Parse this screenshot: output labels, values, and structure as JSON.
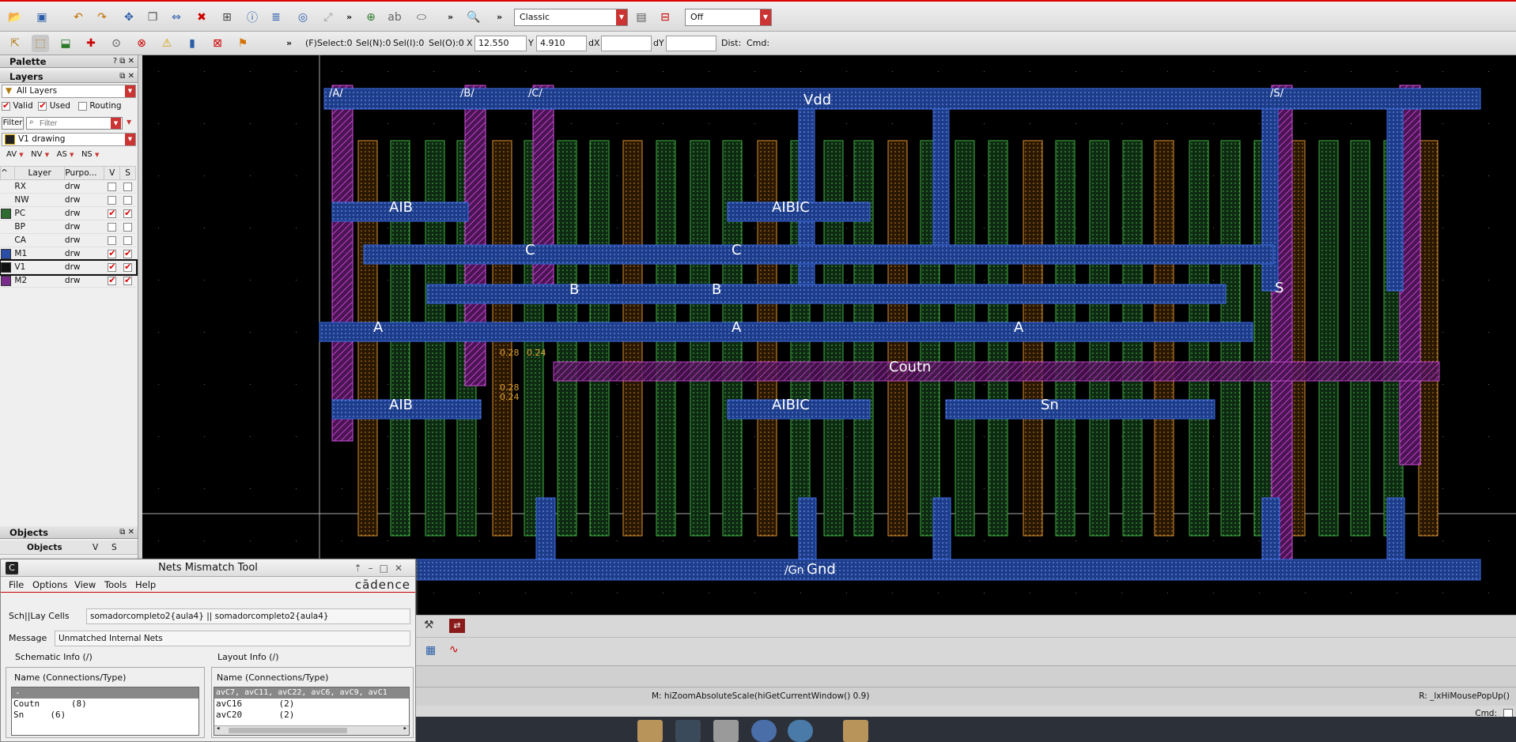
{
  "toolbar": {
    "display_style": "Classic",
    "snap_mode": "Off",
    "overflow_glyph": "»"
  },
  "coordbar": {
    "fselect": "(F)Select:0",
    "seln": "Sel(N):0",
    "seli": "Sel(I):0",
    "selo": "Sel(O):0",
    "x_label": "X",
    "x_value": "12.550",
    "y_label": "Y",
    "y_value": "4.910",
    "dx_label": "dX",
    "dx_value": "",
    "dy_label": "dY",
    "dy_value": "",
    "dist_label": "Dist:",
    "cmd_label": "Cmd:"
  },
  "palette": {
    "title": "Palette",
    "layers_title": "Layers",
    "filter_set": "All Layers",
    "valid_label": "Valid",
    "used_label": "Used",
    "routing_label": "Routing",
    "filter_button": "Filter",
    "filter_placeholder": "Filter",
    "current_layer": "V1 drawing",
    "vis_av": "AV",
    "vis_nv": "NV",
    "vis_as": "AS",
    "vis_ns": "NS",
    "col_layer": "Layer",
    "col_purpose": "Purpo...",
    "col_v": "V",
    "col_s": "S",
    "rows": [
      {
        "layer": "RX",
        "purpose": "drw",
        "v": false,
        "s": false,
        "color": ""
      },
      {
        "layer": "NW",
        "purpose": "drw",
        "v": false,
        "s": false,
        "color": ""
      },
      {
        "layer": "PC",
        "purpose": "drw",
        "v": true,
        "s": true,
        "color": "#2e6b2e"
      },
      {
        "layer": "BP",
        "purpose": "drw",
        "v": false,
        "s": false,
        "color": ""
      },
      {
        "layer": "CA",
        "purpose": "drw",
        "v": false,
        "s": false,
        "color": ""
      },
      {
        "layer": "M1",
        "purpose": "drw",
        "v": true,
        "s": true,
        "color": "#2b4ea8"
      },
      {
        "layer": "V1",
        "purpose": "drw",
        "v": true,
        "s": true,
        "color": "#111111"
      },
      {
        "layer": "M2",
        "purpose": "drw",
        "v": true,
        "s": true,
        "color": "#7a2a8a"
      }
    ],
    "objects_title": "Objects",
    "objects_col": "Objects",
    "objects_v": "V",
    "objects_s": "S"
  },
  "layout": {
    "pins": [
      "/A/",
      "/B/",
      "/C/",
      "/S/"
    ],
    "power": "Vdd",
    "ground": "Gnd",
    "ground_pin": "/Gn",
    "labels": [
      "A",
      "B",
      "C",
      "AIB",
      "AIBIC",
      "Coutn",
      "Cout",
      "Sn",
      "S"
    ],
    "measure_labels": [
      "0.28",
      "0.24",
      "0.28",
      "0.24"
    ]
  },
  "nets_mismatch": {
    "title": "Nets Mismatch Tool",
    "brand": "cādence",
    "menu": [
      "File",
      "Options",
      "View",
      "Tools",
      "Help"
    ],
    "cells_label": "Sch||Lay Cells",
    "cells_value": "somadorcompleto2{aula4}   ||   somadorcompleto2{aula4}",
    "message_label": "Message",
    "message_value": "Unmatched Internal Nets",
    "schematic_info": "Schematic Info  (/)",
    "layout_info": "Layout Info  (/)",
    "col_header": "Name  (Connections/Type)",
    "schematic_rows": [
      "-",
      "Coutn      (8)",
      "Sn     (6)"
    ],
    "layout_rows": [
      "avC7, avC11, avC22, avC6, avC9, avC1",
      "avC16       (2)",
      "avC20       (2)"
    ]
  },
  "status": {
    "left": "M: hiZoomAbsoluteScale(hiGetCurrentWindow() 0.9)",
    "right": "R: _lxHiMousePopUp()",
    "cmd": "Cmd:"
  }
}
